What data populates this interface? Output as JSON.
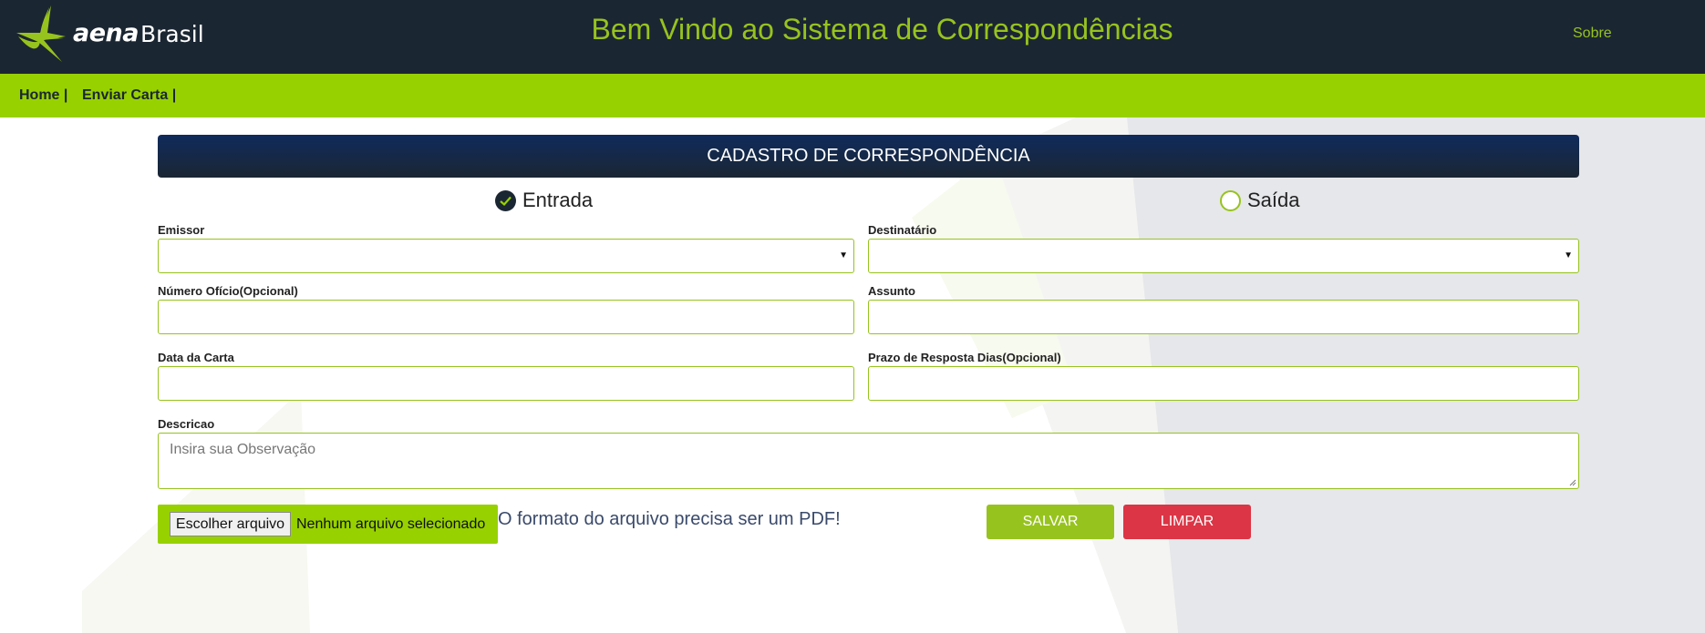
{
  "header": {
    "logo_aena": "aena",
    "logo_brasil": "Brasil",
    "title": "Bem Vindo ao Sistema de Correspondências",
    "about_link": "Sobre"
  },
  "nav": {
    "items": [
      {
        "label": "Home |"
      },
      {
        "label": "Enviar Carta |"
      }
    ]
  },
  "form": {
    "title": "CADASTRO DE CORRESPONDÊNCIA",
    "direction": {
      "options": [
        {
          "label": "Entrada",
          "checked": true
        },
        {
          "label": "Saída",
          "checked": false
        }
      ]
    },
    "fields": {
      "emissor": {
        "label": "Emissor",
        "value": ""
      },
      "destinatario": {
        "label": "Destinatário",
        "value": ""
      },
      "numero_oficio": {
        "label": "Número Ofício(Opcional)",
        "value": ""
      },
      "assunto": {
        "label": "Assunto",
        "value": ""
      },
      "data_carta": {
        "label": "Data da Carta",
        "value": ""
      },
      "prazo": {
        "label": "Prazo de Resposta Dias(Opcional)",
        "value": ""
      },
      "descricao": {
        "label": "Descricao",
        "placeholder": "Insira sua Observação",
        "value": ""
      }
    },
    "file": {
      "button_label": "Escolher arquivo",
      "status": "Nenhum arquivo selecionado",
      "hint": "O formato do arquivo precisa ser um PDF!"
    },
    "actions": {
      "save_label": "SALVAR",
      "clear_label": "LIMPAR"
    }
  },
  "colors": {
    "header_bg": "#1b2633",
    "accent_green": "#97c31e",
    "nav_green": "#97d100",
    "danger_red": "#dc3545"
  },
  "icons": [
    "aena-logo-icon",
    "check-icon",
    "dropdown-arrow-icon",
    "resize-grip-icon"
  ]
}
